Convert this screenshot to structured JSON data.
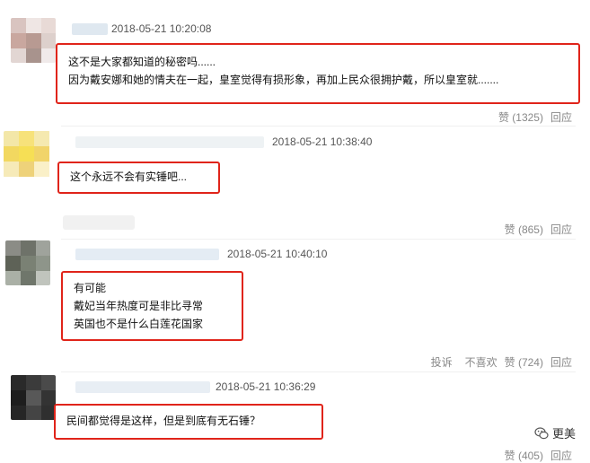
{
  "comments": [
    {
      "timestamp": "2018-05-21 10:20:08",
      "lines": [
        "这不是大家都知道的秘密吗......",
        "因为戴安娜和她的情夫在一起，皇室觉得有损形象，再加上民众很拥护戴，所以皇室就......."
      ],
      "like_label": "赞 (1325)",
      "reply_label": "回应"
    },
    {
      "timestamp": "2018-05-21 10:38:40",
      "lines": [
        "这个永远不会有实锤吧..."
      ],
      "like_label": "赞 (865)",
      "reply_label": "回应"
    },
    {
      "timestamp": "2018-05-21 10:40:10",
      "lines": [
        "有可能",
        "戴妃当年热度可是非比寻常",
        "英国也不是什么白莲花国家"
      ],
      "report_label": "投诉",
      "dislike_label": "不喜欢",
      "like_label": "赞 (724)",
      "reply_label": "回应"
    },
    {
      "timestamp": "2018-05-21 10:36:29",
      "lines": [
        "民间都觉得是这样，但是到底有无石锤？"
      ],
      "like_label": "赞 (405)",
      "reply_label": "回应"
    }
  ],
  "brand": {
    "name": "更美",
    "icon": "wechat-icon"
  },
  "colors": {
    "highlight": "#e0241a",
    "meta": "#888888"
  }
}
